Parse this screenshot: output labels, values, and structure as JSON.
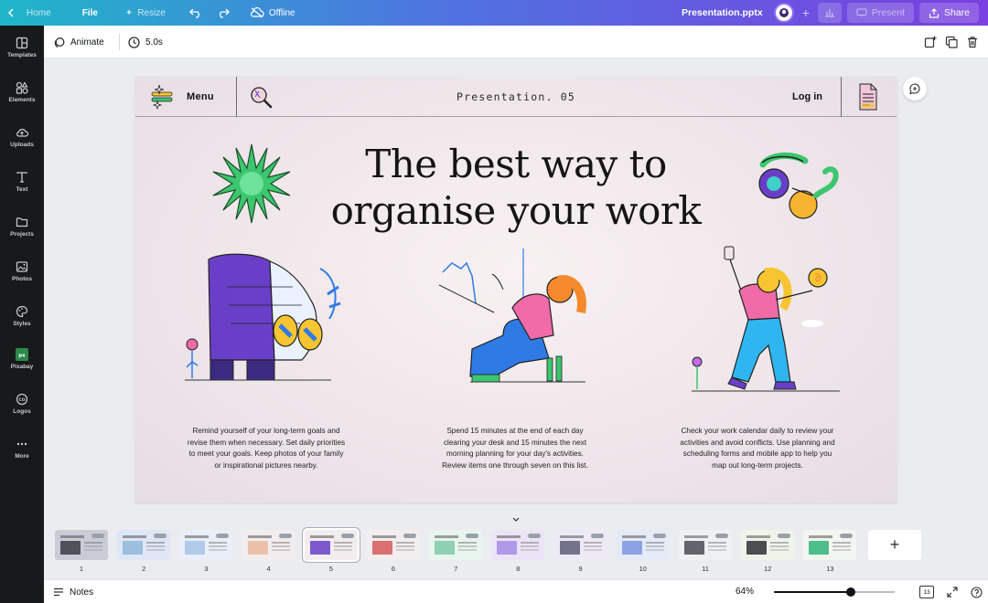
{
  "topbar": {
    "home": "Home",
    "file_menu": "File",
    "resize": "Resize",
    "status": "Offline",
    "filename": "Presentation.pptx",
    "present": "Present",
    "share": "Share"
  },
  "sidebar": {
    "items": [
      {
        "label": "Templates",
        "icon": "templates-icon"
      },
      {
        "label": "Elements",
        "icon": "elements-icon"
      },
      {
        "label": "Uploads",
        "icon": "upload-cloud-icon"
      },
      {
        "label": "Text",
        "icon": "text-icon"
      },
      {
        "label": "Projects",
        "icon": "folder-icon"
      },
      {
        "label": "Photos",
        "icon": "photo-icon"
      },
      {
        "label": "Styles",
        "icon": "palette-icon"
      },
      {
        "label": "Pixabay",
        "icon": "pixabay-icon"
      },
      {
        "label": "Logos",
        "icon": "logo-badge-icon"
      },
      {
        "label": "More",
        "icon": "more-dots-icon"
      }
    ]
  },
  "toolbar": {
    "animate": "Animate",
    "duration": "5.0s"
  },
  "slide": {
    "menu": "Menu",
    "nav_title": "Presentation. 05",
    "login": "Log in",
    "title_line1": "The best way to",
    "title_line2": "organise your work",
    "captions": [
      "Remind yourself of your long-term goals and revise them when necessary. Set daily priorities to meet your goals. Keep photos of your family or inspirational pictures nearby.",
      "Spend 15 minutes at the end of each day clearing your desk and 15 minutes the next morning planning for your day's activities. Review items one through seven on this list.",
      "Check your work calendar daily to review your activities and avoid conflicts. Use planning and scheduling forms and mobile app to help you map out long-term projects."
    ],
    "colors": {
      "purple": "#6a3fc8",
      "pink": "#f06ba8",
      "blue": "#2f7be6",
      "orange": "#f58a2c",
      "yellow": "#f7c531",
      "green": "#3cc66e"
    }
  },
  "thumbnails": [
    {
      "num": "1",
      "bg": "#c9cbd6",
      "accent": "#3c3c46"
    },
    {
      "num": "2",
      "bg": "#dfe6f5",
      "accent": "#8fb7d8"
    },
    {
      "num": "3",
      "bg": "#e9eef8",
      "accent": "#a6c3e6"
    },
    {
      "num": "4",
      "bg": "#f3ecee",
      "accent": "#e8b89f"
    },
    {
      "num": "5",
      "bg": "#f2ecef",
      "accent": "#6a3fc8",
      "selected": true
    },
    {
      "num": "6",
      "bg": "#f2eef0",
      "accent": "#d55a5a"
    },
    {
      "num": "7",
      "bg": "#e8f4ee",
      "accent": "#7fc9a7"
    },
    {
      "num": "8",
      "bg": "#ece4f6",
      "accent": "#a58ce6"
    },
    {
      "num": "9",
      "bg": "#eeeaf5",
      "accent": "#5e5e78"
    },
    {
      "num": "10",
      "bg": "#e5eaf8",
      "accent": "#7d95e0"
    },
    {
      "num": "11",
      "bg": "#eef0f2",
      "accent": "#4a4a55"
    },
    {
      "num": "12",
      "bg": "#eef4ea",
      "accent": "#2f3036"
    },
    {
      "num": "13",
      "bg": "#f3f5f0",
      "accent": "#2fb37a"
    }
  ],
  "bottombar": {
    "notes": "Notes",
    "zoom": "64%",
    "zoom_fraction": 0.64,
    "page_count": "13"
  }
}
